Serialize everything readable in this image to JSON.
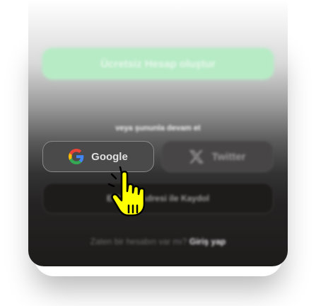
{
  "signup": {
    "create_account_label": "Ücretsiz Hesap oluştur",
    "divider_text": "veya şununla devam et",
    "google_label": "Google",
    "twitter_label": "Twitter",
    "email_label": "E-Posta Adresi ile Kaydol",
    "signin_prompt": "Zaten bir hesabın var mı?",
    "signin_link": "Giriş yap"
  },
  "colors": {
    "cta_green": "#b7ebc6",
    "card_dark": "#1e1b1b",
    "cursor_yellow": "#ffff00"
  },
  "icons": {
    "google": "google-g-icon",
    "twitter": "x-logo-icon",
    "cursor": "hand-pointer-icon"
  }
}
